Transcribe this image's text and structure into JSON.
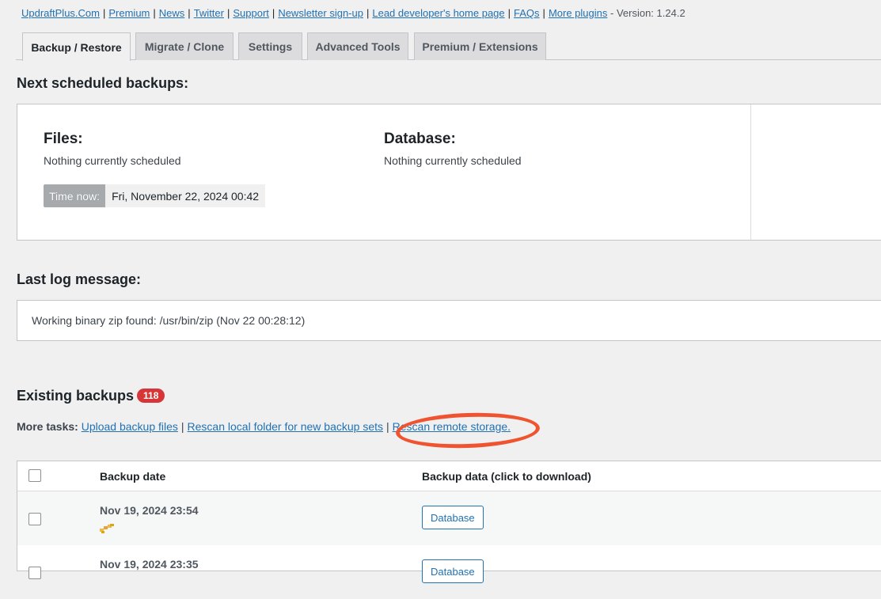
{
  "top_links": {
    "items": [
      "UpdraftPlus.Com",
      "Premium",
      "News",
      "Twitter",
      "Support",
      "Newsletter sign-up",
      "Lead developer's home page",
      "FAQs",
      "More plugins"
    ],
    "version": "- Version: 1.24.2"
  },
  "tabs": [
    {
      "label": "Backup / Restore",
      "active": true
    },
    {
      "label": "Migrate / Clone"
    },
    {
      "label": "Settings"
    },
    {
      "label": "Advanced Tools"
    },
    {
      "label": "Premium / Extensions"
    }
  ],
  "next_scheduled": {
    "heading": "Next scheduled backups:",
    "files_label": "Files:",
    "files_value": "Nothing currently scheduled",
    "database_label": "Database:",
    "database_value": "Nothing currently scheduled",
    "time_now_label": "Time now:",
    "time_now_value": "Fri, November 22, 2024 00:42"
  },
  "last_log": {
    "heading": "Last log message:",
    "message": "Working binary zip found: /usr/bin/zip (Nov 22 00:28:12)"
  },
  "existing_backups": {
    "heading": "Existing backups",
    "count": "118",
    "more_tasks_label": "More tasks:",
    "tasks": [
      "Upload backup files",
      "Rescan local folder for new backup sets",
      "Rescan remote storage."
    ],
    "columns": {
      "date": "Backup date",
      "data": "Backup data (click to download)"
    },
    "rows": [
      {
        "date": "Nov 19, 2024 23:54",
        "button": "Database"
      },
      {
        "date": "Nov 19, 2024 23:35",
        "button": "Database"
      }
    ]
  },
  "colors": {
    "accent": "#2271b1",
    "badge": "#d63638",
    "annotation": "#f0532f"
  }
}
